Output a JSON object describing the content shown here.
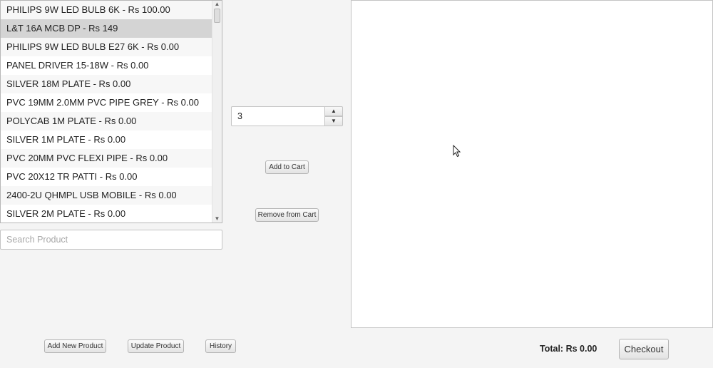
{
  "product_list": {
    "items": [
      "PHILIPS 9W LED BULB 6K - Rs 100.00",
      "L&T 16A MCB DP - Rs 149",
      "PHILIPS 9W LED BULB E27 6K - Rs 0.00",
      "PANEL DRIVER 15-18W - Rs 0.00",
      "SILVER 18M PLATE - Rs 0.00",
      "PVC 19MM 2.0MM PVC PIPE GREY - Rs 0.00",
      "POLYCAB 1M PLATE - Rs 0.00",
      "SILVER 1M PLATE - Rs 0.00",
      "PVC 20MM PVC FLEXI PIPE - Rs 0.00",
      "PVC 20X12 TR PATTI - Rs 0.00",
      "2400-2U QHMPL USB MOBILE - Rs 0.00",
      "SILVER 2M PLATE - Rs 0.00"
    ],
    "selected_item": "L&T 16A MCB DP - Rs 149"
  },
  "search": {
    "placeholder": "Search Product",
    "value": ""
  },
  "quantity": {
    "value": "3"
  },
  "actions": {
    "add_to_cart": "Add to Cart",
    "remove_from_cart": "Remove from Cart"
  },
  "bottom_bar": {
    "add_new_product": "Add New Product",
    "update_product": "Update Product",
    "history": "History",
    "total": "Total: Rs 0.00",
    "checkout": "Checkout"
  },
  "cart": {
    "items": []
  }
}
